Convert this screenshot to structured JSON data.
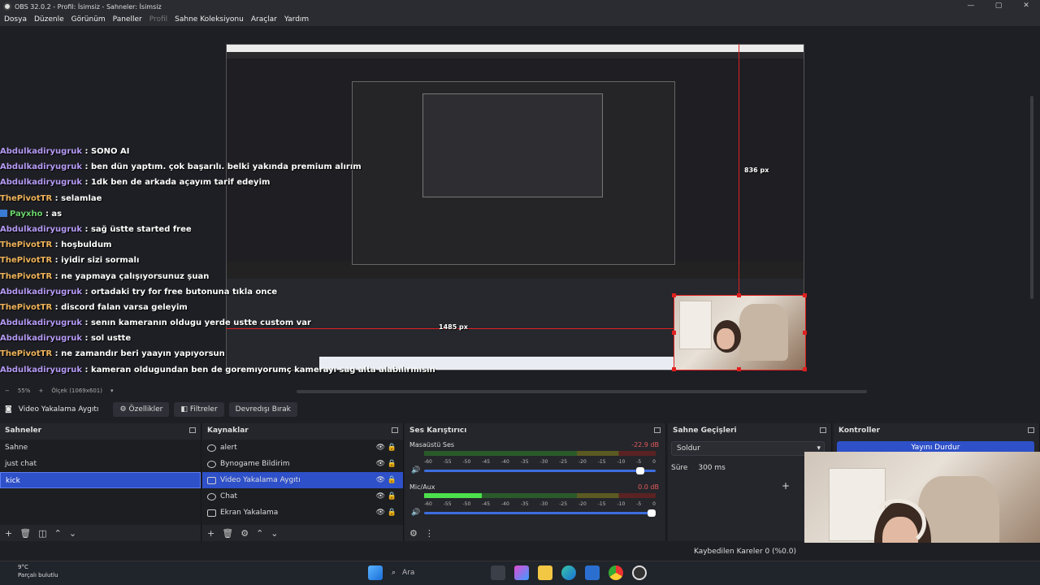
{
  "window": {
    "title": "OBS 32.0.2 - Profil: İsimsiz - Sahneler: İsimsiz",
    "controls": [
      "—",
      "▢",
      "✕"
    ]
  },
  "menu": {
    "items": [
      "Dosya",
      "Düzenle",
      "Görünüm",
      "Paneller",
      "Profil",
      "Sahne Koleksiyonu",
      "Araçlar",
      "Yardım"
    ]
  },
  "chat": {
    "lines": [
      {
        "user": "Abdulkadiryugruk",
        "msg": ": SONO AI",
        "color": "u1"
      },
      {
        "user": "Abdulkadiryugruk",
        "msg": ": ben dün yaptım. çok başarılı. belki yakında premium alırım",
        "color": "u1"
      },
      {
        "user": "Abdulkadiryugruk",
        "msg": ": 1dk ben de arkada açayım tarif edeyim",
        "color": "u1"
      },
      {
        "user": "ThePivotTR",
        "msg": ": selamlae",
        "color": "u2"
      },
      {
        "user": "Payxho",
        "msg": ": as",
        "color": "u3",
        "badge": true
      },
      {
        "user": "Abdulkadiryugruk",
        "msg": ": sağ üstte started free",
        "color": "u1"
      },
      {
        "user": "ThePivotTR",
        "msg": ": hoşbuldum",
        "color": "u2"
      },
      {
        "user": "ThePivotTR",
        "msg": ": iyidir sizi sormalı",
        "color": "u2"
      },
      {
        "user": "ThePivotTR",
        "msg": ": ne yapmaya çalışıyorsunuz şuan",
        "color": "u2"
      },
      {
        "user": "Abdulkadiryugruk",
        "msg": ": ortadaki try for free butonuna tıkla once",
        "color": "u1"
      },
      {
        "user": "ThePivotTR",
        "msg": ": discord falan varsa geleyim",
        "color": "u2"
      },
      {
        "user": "Abdulkadiryugruk",
        "msg": ": senın kameranın oldugu yerde ustte custom var",
        "color": "u1"
      },
      {
        "user": "Abdulkadiryugruk",
        "msg": ": sol ustte",
        "color": "u1"
      },
      {
        "user": "ThePivotTR",
        "msg": ": ne zamandır beri yaayın yapıyorsun",
        "color": "u2"
      },
      {
        "user": "Abdulkadiryugruk",
        "msg": ": kameran oldugundan ben de goremıyorumç kamerayı sag alta alabılırmısın",
        "color": "u1"
      }
    ]
  },
  "preview": {
    "dim_top": "836 px",
    "dim_left": "1485 px",
    "zoom_label": "55%",
    "scale_label": "Ölçek (1069x601)"
  },
  "context": {
    "source_name": "Video Yakalama Aygıtı",
    "buttons": [
      "Özellikler",
      "Filtreler",
      "Devredışı Bırak"
    ]
  },
  "scenes": {
    "title": "Sahneler",
    "items": [
      "Sahne",
      "just chat",
      "kick"
    ],
    "selected": 2
  },
  "sources": {
    "title": "Kaynaklar",
    "items": [
      "alert",
      "Bynogame Bildirim",
      "Video Yakalama Aygıtı",
      "Chat",
      "Ekran Yakalama"
    ],
    "selected": 2
  },
  "mixer": {
    "title": "Ses Karıştırıcı",
    "tracks": [
      {
        "name": "Masaüstü Ses",
        "db": "-22.9 dB",
        "level": 0.0,
        "volume": 0.95
      },
      {
        "name": "Mic/Aux",
        "db": "0.0 dB",
        "level": 0.25,
        "volume": 1.0
      }
    ],
    "scale": [
      "-60",
      "-55",
      "-50",
      "-45",
      "-40",
      "-35",
      "-30",
      "-25",
      "-20",
      "-15",
      "-10",
      "-5",
      "0"
    ]
  },
  "transitions": {
    "title": "Sahne Geçişleri",
    "selected": "Soldur",
    "duration_label": "Süre",
    "duration_value": "300 ms"
  },
  "controls": {
    "title": "Kontroller",
    "stop_stream": "Yayını Durdur"
  },
  "status": {
    "dropped_frames": "Kaybedilen Kareler 0 (%0.0)"
  },
  "taskbar": {
    "weather_temp": "9°C",
    "weather_desc": "Parçalı bulutlu",
    "search": "Ara"
  },
  "colors": {
    "accent": "#2e50c8",
    "guide": "#e02020",
    "panel": "#25262b",
    "bg": "#1e1f24"
  }
}
